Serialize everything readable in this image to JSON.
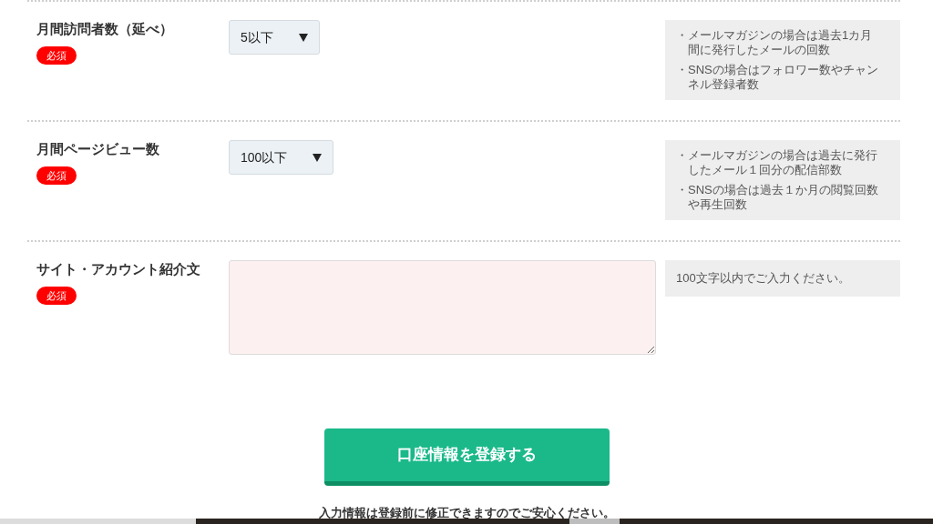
{
  "fields": [
    {
      "label": "月間訪問者数（延べ）",
      "required": "必須",
      "kind": "select",
      "value": "5以下",
      "notes": [
        {
          "bullet": "・",
          "text": "メールマガジンの場合は過去1カ月間に発行したメールの回数"
        },
        {
          "bullet": "・",
          "text": "SNSの場合はフォロワー数やチャンネル登録者数"
        }
      ]
    },
    {
      "label": "月間ページビュー数",
      "required": "必須",
      "kind": "select",
      "value": "100以下",
      "notes": [
        {
          "bullet": "・",
          "text": "メールマガジンの場合は過去に発行したメール１回分の配信部数"
        },
        {
          "bullet": "・",
          "text": "SNSの場合は過去１か月の閲覧回数や再生回数"
        }
      ]
    },
    {
      "label": "サイト・アカウント紹介文",
      "required": "必須",
      "kind": "textarea",
      "hint": "100文字以内でご入力ください。"
    }
  ],
  "submit": "口座情報を登録する",
  "footnote": "入力情報は登録前に修正できますのでご安心ください。"
}
